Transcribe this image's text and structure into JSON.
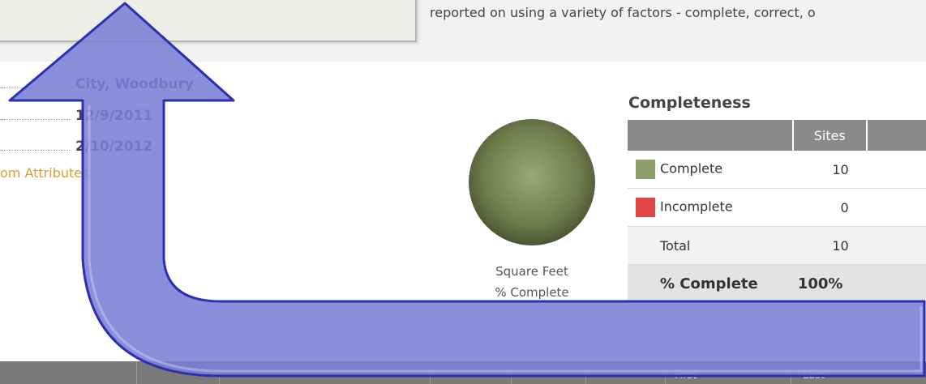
{
  "header": {
    "description_text": "reported on using a variety of factors - complete, correct, o"
  },
  "details": {
    "org_value": "City, Woodbury",
    "date1_value": "12/9/2011",
    "date2_value": "2/10/2012",
    "custom_attributes_link": "om Attributes"
  },
  "pie": {
    "caption_line1": "Square Feet",
    "caption_line2": "% Complete",
    "color": "#7f8c5a"
  },
  "completeness": {
    "title": "Completeness",
    "col_sites": "Sites",
    "rows": [
      {
        "label": "Complete",
        "sites": "10",
        "color": "#8e9f6a"
      },
      {
        "label": "Incomplete",
        "sites": "0",
        "color": "#e04848"
      },
      {
        "label": "Total",
        "sites": "10"
      }
    ],
    "pct_label": "% Complete",
    "pct_value": "100%"
  },
  "bottom_bar": {
    "col_first": "First",
    "col_last": "Last"
  },
  "colors": {
    "arrow_fill": "#7b7fd6",
    "arrow_stroke": "#2c2fb0",
    "header_gray": "#8a8a8a"
  },
  "chart_data": {
    "type": "pie",
    "title": "",
    "categories": [
      "Complete",
      "Incomplete"
    ],
    "values": [
      10,
      0
    ]
  }
}
